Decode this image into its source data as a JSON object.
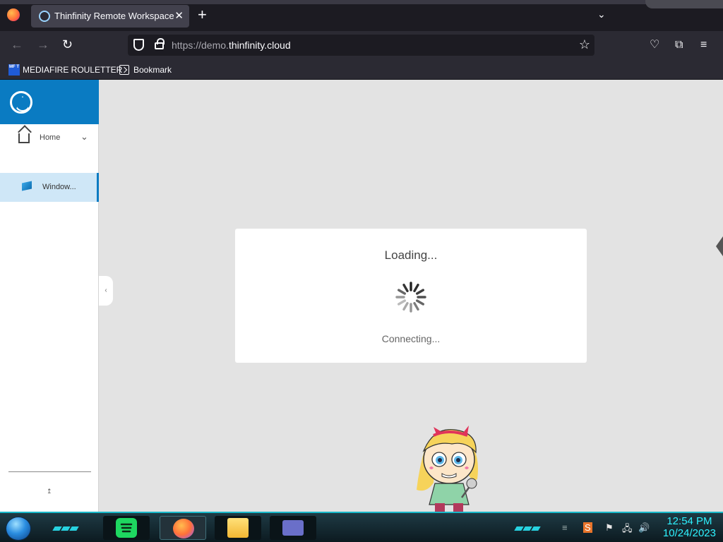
{
  "browser": {
    "tab_title": "Thinfinity Remote Workspace",
    "tab_close": "✕",
    "new_tab": "+",
    "tab_list": "⌄",
    "url_dim_prefix": "https://demo.",
    "url_domain": "thinfinity.cloud",
    "nav_back": "←",
    "nav_forward": "→",
    "nav_reload": "↻",
    "bookmark_star": "☆",
    "toolbar_pocket": "♡",
    "toolbar_extensions": "⧉",
    "toolbar_menu": "≡"
  },
  "bookmarks": [
    {
      "label": "MEDIAFIRE ROULETTER",
      "icon": "mf-icon",
      "icon_text": "MF T"
    },
    {
      "label": "Bookmark",
      "icon": "page-icon"
    }
  ],
  "sidebar": {
    "home_label": "Home",
    "home_chevron": "⌄",
    "items": [
      {
        "label": "Window...",
        "icon": "windows-icon",
        "selected": true
      }
    ],
    "collapse_glyph": "‹",
    "pin_glyph": "↥"
  },
  "dialog": {
    "title": "Loading...",
    "status": "Connecting..."
  },
  "taskbar": {
    "apps": [
      "spotify",
      "firefox",
      "file-explorer",
      "window-app"
    ],
    "tray": {
      "flag": "⚑",
      "network": "🖧",
      "volume": "🔊"
    },
    "clock_time": "12:54 PM",
    "clock_date": "10/24/2023"
  },
  "colors": {
    "accent_blue": "#0a7bc2",
    "sidebar_selected": "#cfe7f7",
    "taskbar_cyan": "#2ef2ff",
    "spotify_green": "#1ed760"
  }
}
